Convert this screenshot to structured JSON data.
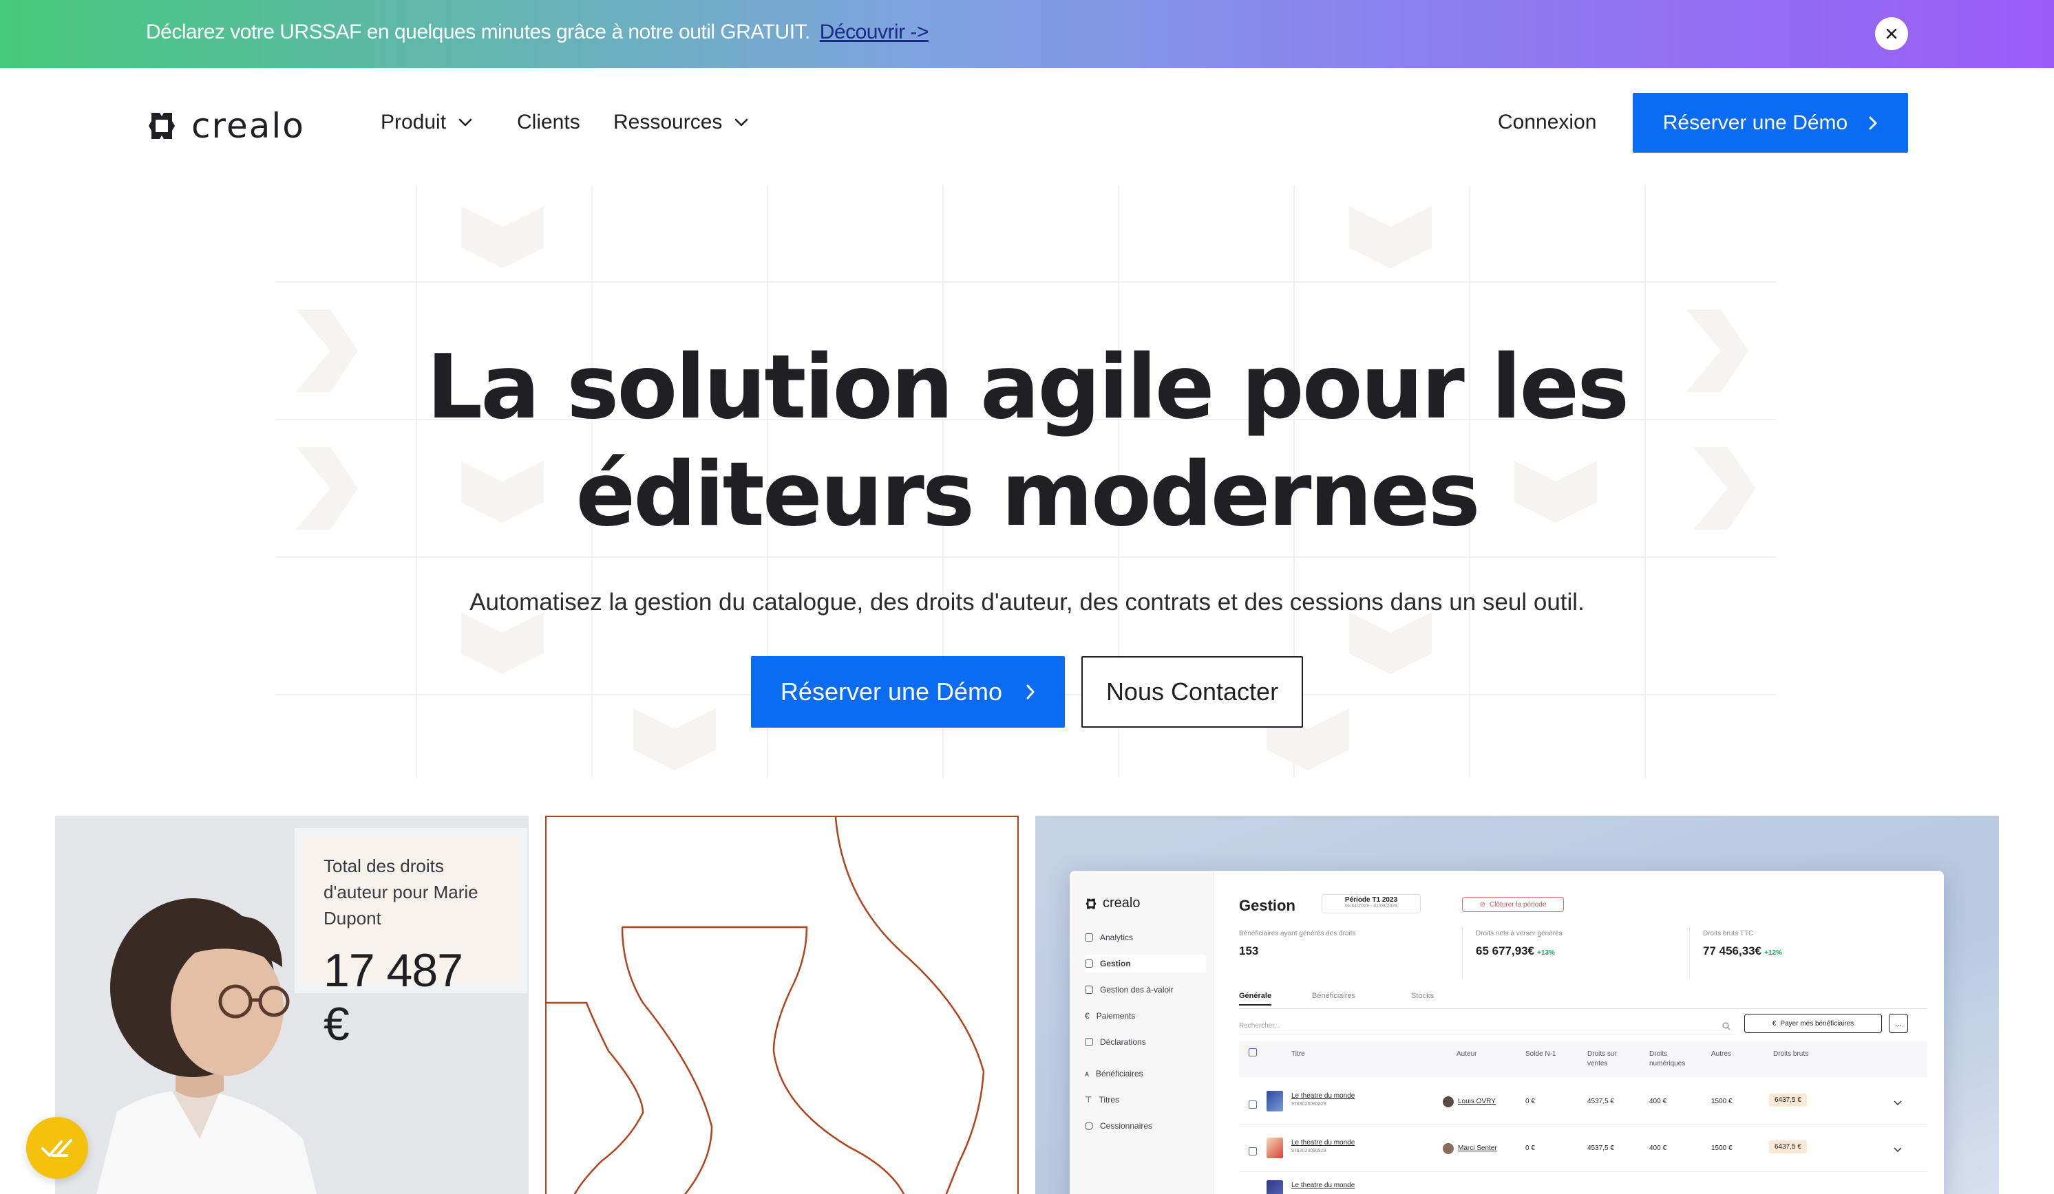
{
  "promo": {
    "text": "Déclarez votre URSSAF en quelques minutes grâce à notre outil GRATUIT.",
    "link": "Découvrir ->",
    "close_icon": "close-icon"
  },
  "nav": {
    "logo": "crealo",
    "items": [
      {
        "label": "Produit",
        "has_dropdown": true
      },
      {
        "label": "Clients",
        "has_dropdown": false
      },
      {
        "label": "Ressources",
        "has_dropdown": true
      }
    ],
    "login": "Connexion",
    "cta": "Réserver une Démo"
  },
  "hero": {
    "title_line1": "La solution agile pour les",
    "title_line2": "éditeurs modernes",
    "subtitle": "Automatisez la gestion du catalogue, des droits d'auteur, des contrats et des cessions dans un seul outil.",
    "primary_cta": "Réserver une Démo",
    "secondary_cta": "Nous Contacter"
  },
  "stat_card": {
    "label": "Total des droits d'auteur pour Marie Dupont",
    "value": "17 487 €"
  },
  "app": {
    "logo": "crealo",
    "sidebar": [
      {
        "label": "Analytics",
        "active": false
      },
      {
        "label": "Gestion",
        "active": true
      },
      {
        "label": "Gestion des à-valoir",
        "active": false
      },
      {
        "label": "Paiements",
        "active": false
      },
      {
        "label": "Déclarations",
        "active": false
      },
      {
        "label": "Bénéficiaires",
        "active": false
      },
      {
        "label": "Titres",
        "active": false
      },
      {
        "label": "Cessionnaires",
        "active": false
      }
    ],
    "title": "Gestion",
    "period": {
      "label": "Période T1 2023",
      "dates": "01/01/2023 - 31/03/2023"
    },
    "close_period": "Clôturer la période",
    "kpis": [
      {
        "label": "Bénéficiaires ayant générés des droits",
        "value": "153",
        "growth": ""
      },
      {
        "label": "Droits nets à verser générés",
        "value": "65 677,93€",
        "growth": "+13%"
      },
      {
        "label": "Droits bruts TTC",
        "value": "77 456,33€",
        "growth": "+12%"
      }
    ],
    "tabs": [
      "Générale",
      "Bénéficiaires",
      "Stocks"
    ],
    "search_placeholder": "Rechercher...",
    "pay_button": "Payer mes bénéficiaires",
    "more_button": "...",
    "columns": [
      "Titre",
      "Auteur",
      "Solde N-1",
      "Droits sur ventes",
      "Droits numériques",
      "Autres",
      "Droits bruts"
    ],
    "rows": [
      {
        "title": "Le theatre du monde",
        "isbn": "9783023090829",
        "author": "Louis OVRY",
        "solde": "0 €",
        "ventes": "4537,5 €",
        "numeriques": "400 €",
        "autres": "1500 €",
        "bruts": "6437,5 €"
      },
      {
        "title": "Le theatre du monde",
        "isbn": "9783023090829",
        "author": "Marci Senter",
        "solde": "0 €",
        "ventes": "4537,5 €",
        "numeriques": "400 €",
        "autres": "1500 €",
        "bruts": "6437,5 €"
      },
      {
        "title": "Le theatre du monde",
        "isbn": "",
        "author": "",
        "solde": "",
        "ventes": "",
        "numeriques": "",
        "autres": "",
        "bruts": ""
      }
    ]
  },
  "colors": {
    "primary": "#0a6cf2",
    "brand_shape": "#b0441c",
    "promo_start": "#45c97a",
    "promo_end": "#9a5cf6",
    "float_badge": "#f4c20d"
  }
}
